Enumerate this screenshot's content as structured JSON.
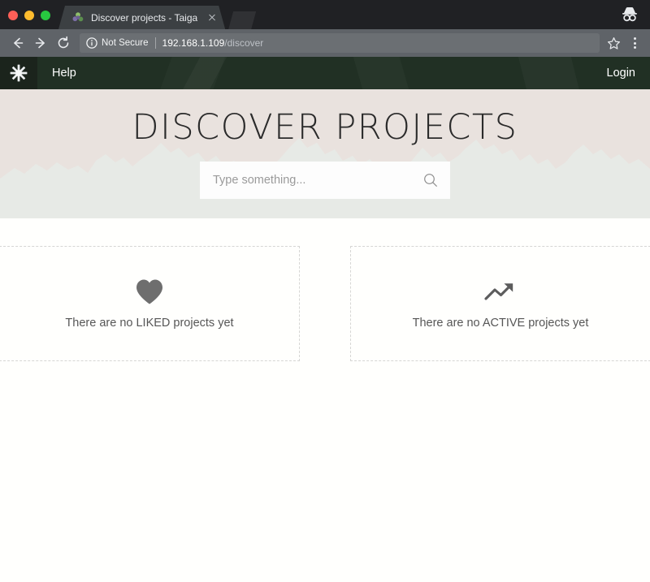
{
  "browser": {
    "tab": {
      "title": "Discover projects - Taiga",
      "favicon_icon": "taiga-flower-favicon",
      "close_icon": "close-icon"
    },
    "new_tab_icon": "new-tab-stub",
    "incognito_icon": "incognito-icon",
    "window_controls": {
      "close": "close-window-dot",
      "minimize": "minimize-window-dot",
      "maximize": "maximize-window-dot"
    },
    "toolbar": {
      "back_icon": "back-arrow-icon",
      "forward_icon": "forward-arrow-icon",
      "reload_icon": "reload-icon",
      "security_icon": "info-circle-icon",
      "security_label": "Not Secure",
      "url_host": "192.168.1.109",
      "url_path": "/discover",
      "bookmark_icon": "star-icon",
      "menu_icon": "three-dot-menu-icon"
    }
  },
  "app": {
    "nav": {
      "logo_icon": "taiga-flower-logo",
      "help_label": "Help",
      "login_label": "Login"
    },
    "hero": {
      "title": "DISCOVER PROJECTS",
      "search_placeholder": "Type something...",
      "search_value": "",
      "search_icon": "search-icon"
    },
    "empty_states": [
      {
        "icon": "heart-icon",
        "text": "There are no LIKED projects yet"
      },
      {
        "icon": "trending-up-icon",
        "text": "There are no ACTIVE projects yet"
      }
    ]
  },
  "colors": {
    "nav_green": "#213024",
    "hero_sky": "#e9e2de",
    "hero_mountain": "#e7eae6",
    "icon_grey": "#6e6e6e",
    "accent_not_secure": "#f1f3f4"
  }
}
